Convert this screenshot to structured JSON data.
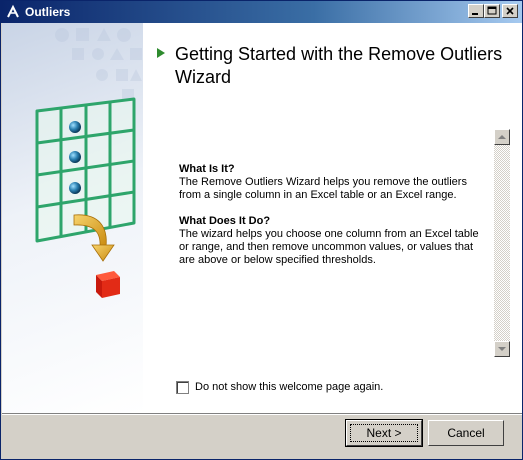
{
  "window": {
    "title": "Outliers",
    "icon": "outliers-app-icon",
    "controls": [
      "minimize-icon",
      "maximize-icon",
      "close-icon"
    ]
  },
  "wizard": {
    "heading": "Getting Started with the Remove Outliers Wizard",
    "sections": [
      {
        "title": "What Is It?",
        "body": "The Remove Outliers Wizard helps you remove the outliers from a single column in an Excel table or an Excel range."
      },
      {
        "title": "What Does It Do?",
        "body": "The wizard helps you choose one column from an Excel table or range, and then remove uncommon values, or values that are above or below specified thresholds."
      }
    ],
    "checkbox": {
      "label": "Do not show this welcome page again.",
      "checked": false
    }
  },
  "buttons": {
    "next": "Next >",
    "cancel": "Cancel"
  },
  "colors": {
    "titlebar_start": "#0a246a",
    "grid_green": "#2ea56b",
    "arrow_green": "#2e8b2e",
    "cube_red": "#cc1b10",
    "arrow_gold": "#e0a020"
  }
}
